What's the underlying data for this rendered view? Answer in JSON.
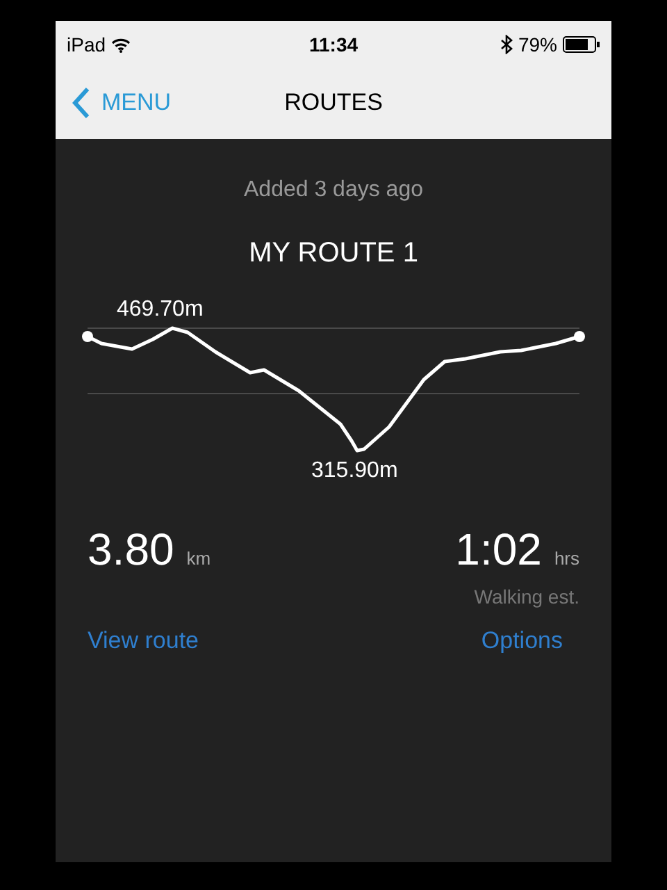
{
  "status_bar": {
    "device": "iPad",
    "time": "11:34",
    "battery": "79%"
  },
  "nav": {
    "back": "MENU",
    "title": "ROUTES"
  },
  "route": {
    "added": "Added 3 days ago",
    "name": "MY ROUTE 1",
    "max_elevation": "469.70m",
    "min_elevation": "315.90m",
    "distance": "3.80",
    "distance_unit": "km",
    "duration": "1:02",
    "duration_unit": "hrs",
    "duration_note": "Walking est."
  },
  "links": [
    "View route",
    "Options"
  ]
}
